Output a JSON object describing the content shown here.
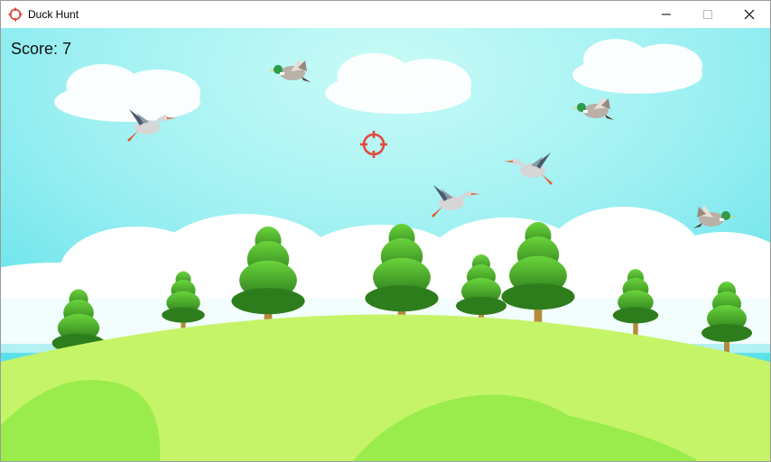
{
  "window": {
    "title": "Duck Hunt",
    "icon": "crosshair-icon",
    "controls": [
      "minimize-icon",
      "maximize-icon",
      "close-icon"
    ]
  },
  "game": {
    "score_label": "Score:",
    "score_value": "7"
  },
  "colors": {
    "sky_top": "#5fe0ea",
    "sky_bottom": "#a9f4f7",
    "hill": "#c6f468",
    "hill_shade": "#9aec4c",
    "tree_light": "#5dc737",
    "tree_dark": "#2e7d1c",
    "trunk": "#b58a3c",
    "crosshair": "#e04a3c"
  },
  "ducks": [
    {
      "kind": "mallard",
      "direction": "left"
    },
    {
      "kind": "mallard",
      "direction": "left"
    },
    {
      "kind": "mallard",
      "direction": "right"
    },
    {
      "kind": "heron",
      "direction": "right"
    },
    {
      "kind": "heron",
      "direction": "left"
    },
    {
      "kind": "heron",
      "direction": "right"
    }
  ]
}
